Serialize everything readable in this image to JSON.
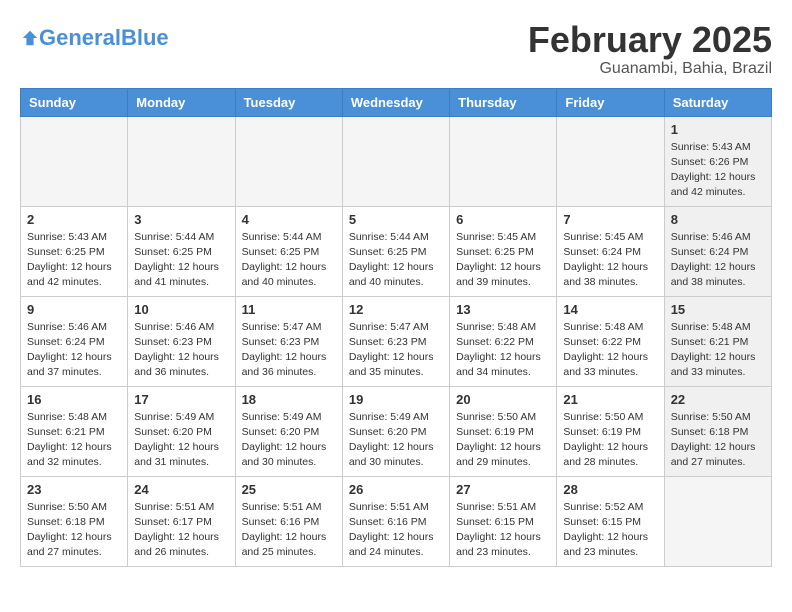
{
  "header": {
    "logo_text_general": "General",
    "logo_text_blue": "Blue",
    "title": "February 2025",
    "subtitle": "Guanambi, Bahia, Brazil"
  },
  "weekdays": [
    "Sunday",
    "Monday",
    "Tuesday",
    "Wednesday",
    "Thursday",
    "Friday",
    "Saturday"
  ],
  "weeks": [
    [
      {
        "day": "",
        "info": "",
        "empty": true
      },
      {
        "day": "",
        "info": "",
        "empty": true
      },
      {
        "day": "",
        "info": "",
        "empty": true
      },
      {
        "day": "",
        "info": "",
        "empty": true
      },
      {
        "day": "",
        "info": "",
        "empty": true
      },
      {
        "day": "",
        "info": "",
        "empty": true
      },
      {
        "day": "1",
        "info": "Sunrise: 5:43 AM\nSunset: 6:26 PM\nDaylight: 12 hours\nand 42 minutes.",
        "shaded": true
      }
    ],
    [
      {
        "day": "2",
        "info": "Sunrise: 5:43 AM\nSunset: 6:25 PM\nDaylight: 12 hours\nand 42 minutes."
      },
      {
        "day": "3",
        "info": "Sunrise: 5:44 AM\nSunset: 6:25 PM\nDaylight: 12 hours\nand 41 minutes."
      },
      {
        "day": "4",
        "info": "Sunrise: 5:44 AM\nSunset: 6:25 PM\nDaylight: 12 hours\nand 40 minutes."
      },
      {
        "day": "5",
        "info": "Sunrise: 5:44 AM\nSunset: 6:25 PM\nDaylight: 12 hours\nand 40 minutes."
      },
      {
        "day": "6",
        "info": "Sunrise: 5:45 AM\nSunset: 6:25 PM\nDaylight: 12 hours\nand 39 minutes."
      },
      {
        "day": "7",
        "info": "Sunrise: 5:45 AM\nSunset: 6:24 PM\nDaylight: 12 hours\nand 38 minutes."
      },
      {
        "day": "8",
        "info": "Sunrise: 5:46 AM\nSunset: 6:24 PM\nDaylight: 12 hours\nand 38 minutes.",
        "shaded": true
      }
    ],
    [
      {
        "day": "9",
        "info": "Sunrise: 5:46 AM\nSunset: 6:24 PM\nDaylight: 12 hours\nand 37 minutes."
      },
      {
        "day": "10",
        "info": "Sunrise: 5:46 AM\nSunset: 6:23 PM\nDaylight: 12 hours\nand 36 minutes."
      },
      {
        "day": "11",
        "info": "Sunrise: 5:47 AM\nSunset: 6:23 PM\nDaylight: 12 hours\nand 36 minutes."
      },
      {
        "day": "12",
        "info": "Sunrise: 5:47 AM\nSunset: 6:23 PM\nDaylight: 12 hours\nand 35 minutes."
      },
      {
        "day": "13",
        "info": "Sunrise: 5:48 AM\nSunset: 6:22 PM\nDaylight: 12 hours\nand 34 minutes."
      },
      {
        "day": "14",
        "info": "Sunrise: 5:48 AM\nSunset: 6:22 PM\nDaylight: 12 hours\nand 33 minutes."
      },
      {
        "day": "15",
        "info": "Sunrise: 5:48 AM\nSunset: 6:21 PM\nDaylight: 12 hours\nand 33 minutes.",
        "shaded": true
      }
    ],
    [
      {
        "day": "16",
        "info": "Sunrise: 5:48 AM\nSunset: 6:21 PM\nDaylight: 12 hours\nand 32 minutes."
      },
      {
        "day": "17",
        "info": "Sunrise: 5:49 AM\nSunset: 6:20 PM\nDaylight: 12 hours\nand 31 minutes."
      },
      {
        "day": "18",
        "info": "Sunrise: 5:49 AM\nSunset: 6:20 PM\nDaylight: 12 hours\nand 30 minutes."
      },
      {
        "day": "19",
        "info": "Sunrise: 5:49 AM\nSunset: 6:20 PM\nDaylight: 12 hours\nand 30 minutes."
      },
      {
        "day": "20",
        "info": "Sunrise: 5:50 AM\nSunset: 6:19 PM\nDaylight: 12 hours\nand 29 minutes."
      },
      {
        "day": "21",
        "info": "Sunrise: 5:50 AM\nSunset: 6:19 PM\nDaylight: 12 hours\nand 28 minutes."
      },
      {
        "day": "22",
        "info": "Sunrise: 5:50 AM\nSunset: 6:18 PM\nDaylight: 12 hours\nand 27 minutes.",
        "shaded": true
      }
    ],
    [
      {
        "day": "23",
        "info": "Sunrise: 5:50 AM\nSunset: 6:18 PM\nDaylight: 12 hours\nand 27 minutes."
      },
      {
        "day": "24",
        "info": "Sunrise: 5:51 AM\nSunset: 6:17 PM\nDaylight: 12 hours\nand 26 minutes."
      },
      {
        "day": "25",
        "info": "Sunrise: 5:51 AM\nSunset: 6:16 PM\nDaylight: 12 hours\nand 25 minutes."
      },
      {
        "day": "26",
        "info": "Sunrise: 5:51 AM\nSunset: 6:16 PM\nDaylight: 12 hours\nand 24 minutes."
      },
      {
        "day": "27",
        "info": "Sunrise: 5:51 AM\nSunset: 6:15 PM\nDaylight: 12 hours\nand 23 minutes."
      },
      {
        "day": "28",
        "info": "Sunrise: 5:52 AM\nSunset: 6:15 PM\nDaylight: 12 hours\nand 23 minutes."
      },
      {
        "day": "",
        "info": "",
        "empty": true,
        "shaded": true
      }
    ]
  ]
}
